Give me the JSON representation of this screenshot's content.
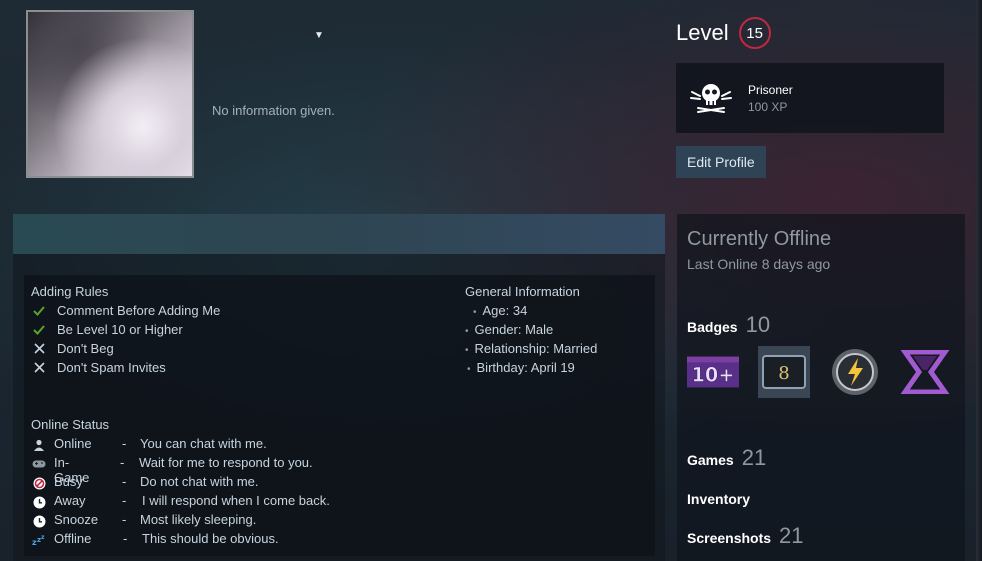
{
  "profile": {
    "no_info": "No information given."
  },
  "level": {
    "label": "Level",
    "value": "15"
  },
  "favorite_badge": {
    "name": "Prisoner",
    "xp": "100 XP",
    "icon": "skull-crossbones-icon"
  },
  "edit_profile_label": "Edit Profile",
  "summary": {
    "adding_rules": {
      "title": "Adding Rules",
      "items": [
        {
          "mark": "check",
          "text": "Comment Before Adding Me"
        },
        {
          "mark": "check",
          "text": "Be Level 10 or Higher"
        },
        {
          "mark": "cross",
          "text": "Don't Beg"
        },
        {
          "mark": "cross",
          "text": "Don't Spam Invites"
        }
      ]
    },
    "general_info": {
      "title": "General Information",
      "items": [
        "Age: 34",
        "Gender: Male",
        "Relationship: Married",
        "Birthday: April 19"
      ]
    },
    "online_status": {
      "title": "Online Status",
      "items": [
        {
          "icon": "person-icon",
          "name": "Online",
          "dash": "-",
          "desc": "You can chat with me."
        },
        {
          "icon": "gamepad-icon",
          "name": "In-Game",
          "dash": "-",
          "desc": "Wait for me to respond to you."
        },
        {
          "icon": "no-entry-icon",
          "name": "Busy",
          "dash": "-",
          "desc": "Do not chat with me."
        },
        {
          "icon": "clock-icon",
          "name": "Away",
          "dash": "-",
          "desc": "I will respond when I come back."
        },
        {
          "icon": "clock-icon",
          "name": "Snooze",
          "dash": "-",
          "desc": "Most likely sleeping."
        },
        {
          "icon": "zzz-icon",
          "name": "Offline",
          "dash": "-",
          "desc": "This should be obvious."
        }
      ]
    }
  },
  "status_panel": {
    "title": "Currently Offline",
    "last_online": "Last Online 8 days ago",
    "badges_label": "Badges",
    "badges_count": "10",
    "games_label": "Games",
    "games_count": "21",
    "inventory_label": "Inventory",
    "screenshots_label": "Screenshots",
    "screenshots_count": "21",
    "badge_icons": [
      {
        "icon": "years-of-service-badge-icon",
        "text": "10+"
      },
      {
        "icon": "game-card-badge-icon",
        "text": "8"
      },
      {
        "icon": "lightning-badge-icon",
        "text": ""
      },
      {
        "icon": "hourglass-badge-icon",
        "text": ""
      }
    ]
  },
  "colors": {
    "level_ring": "#c02942",
    "check": "#5ba32b",
    "edit_button": "#2f4356",
    "badge_purple": "#7a3fa0"
  }
}
